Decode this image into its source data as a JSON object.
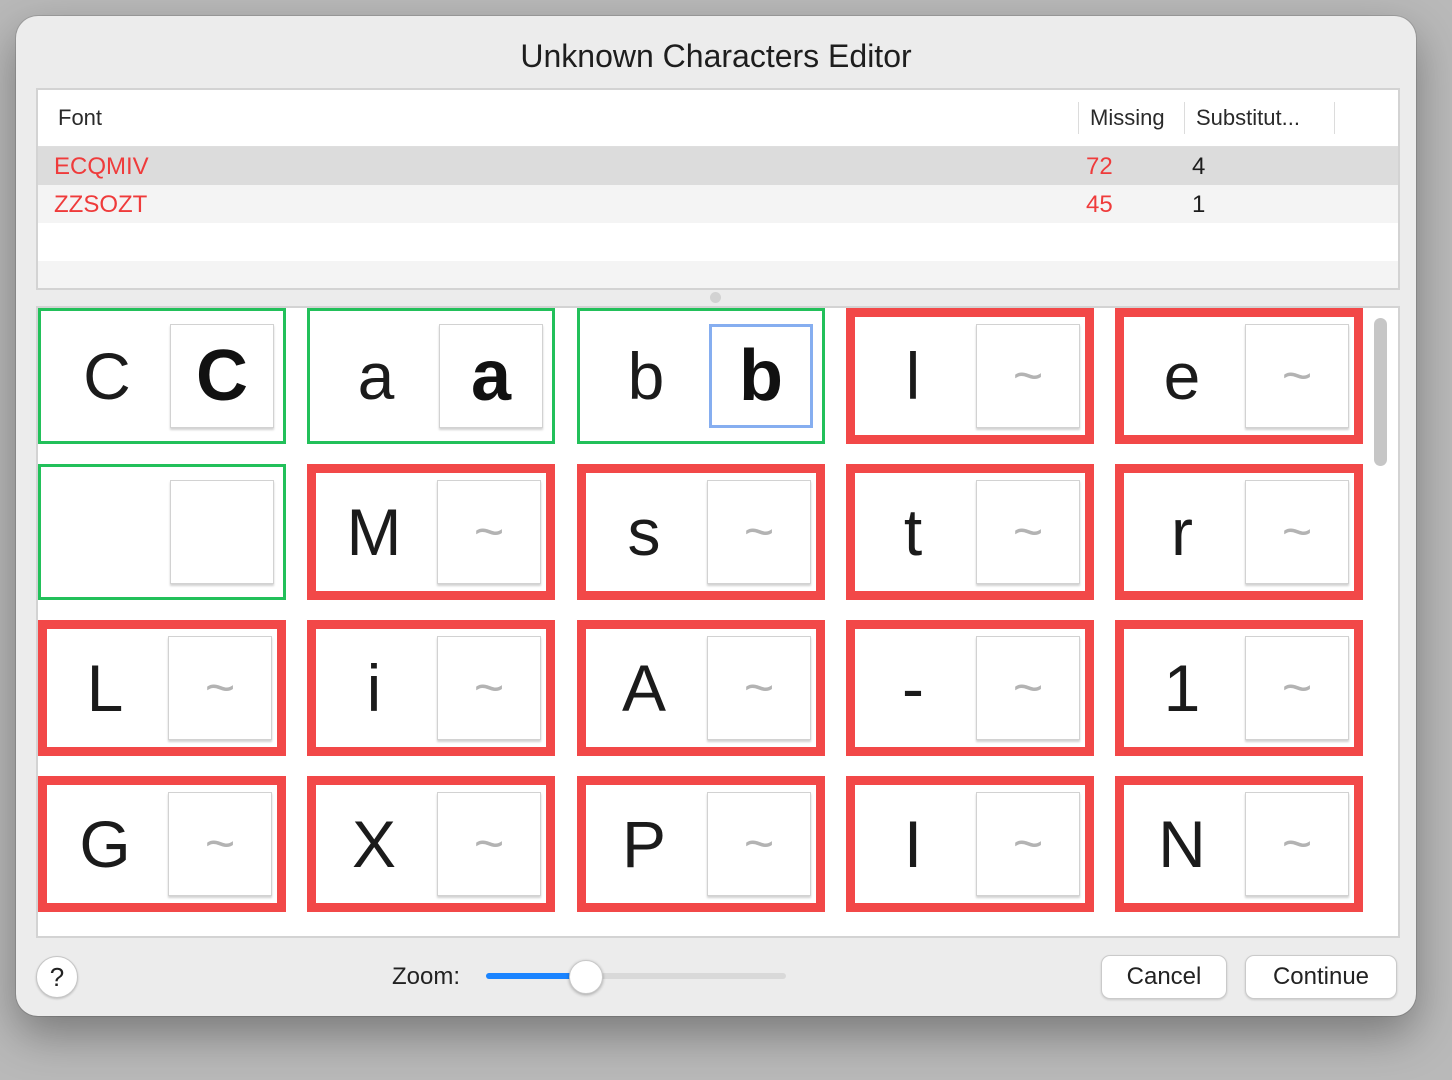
{
  "dialog": {
    "title": "Unknown Characters Editor"
  },
  "table": {
    "columns": {
      "font": "Font",
      "missing": "Missing",
      "substitutions": "Substitut..."
    },
    "rows": [
      {
        "font": "ECQMIV",
        "missing": "72",
        "substitutions": "4",
        "selected": true
      },
      {
        "font": "ZZSOZT",
        "missing": "45",
        "substitutions": "1",
        "selected": false
      }
    ]
  },
  "grid": {
    "substitute_placeholder": "~",
    "cards": [
      {
        "original": "C",
        "substitute": "C",
        "status": "ok"
      },
      {
        "original": "a",
        "substitute": "a",
        "status": "ok"
      },
      {
        "original": "b",
        "substitute": "b",
        "status": "ok",
        "selected": true
      },
      {
        "original": "l",
        "substitute": "",
        "status": "missing"
      },
      {
        "original": "e",
        "substitute": "",
        "status": "missing"
      },
      {
        "original": "",
        "substitute": "",
        "status": "ok"
      },
      {
        "original": "M",
        "substitute": "",
        "status": "missing"
      },
      {
        "original": "s",
        "substitute": "",
        "status": "missing"
      },
      {
        "original": "t",
        "substitute": "",
        "status": "missing"
      },
      {
        "original": "r",
        "substitute": "",
        "status": "missing"
      },
      {
        "original": "L",
        "substitute": "",
        "status": "missing"
      },
      {
        "original": "i",
        "substitute": "",
        "status": "missing"
      },
      {
        "original": "A",
        "substitute": "",
        "status": "missing"
      },
      {
        "original": "-",
        "substitute": "",
        "status": "missing"
      },
      {
        "original": "1",
        "substitute": "",
        "status": "missing"
      },
      {
        "original": "G",
        "substitute": "",
        "status": "missing"
      },
      {
        "original": "X",
        "substitute": "",
        "status": "missing"
      },
      {
        "original": "P",
        "substitute": "",
        "status": "missing"
      },
      {
        "original": "I",
        "substitute": "",
        "status": "missing"
      },
      {
        "original": "N",
        "substitute": "",
        "status": "missing"
      }
    ]
  },
  "footer": {
    "help_label": "?",
    "zoom_label": "Zoom:",
    "zoom_value": 0.33,
    "cancel_label": "Cancel",
    "continue_label": "Continue"
  },
  "colors": {
    "ok_border": "#22c05a",
    "missing_border": "#f24848",
    "missing_text": "#ef3b3b",
    "accent": "#1a84ff"
  }
}
